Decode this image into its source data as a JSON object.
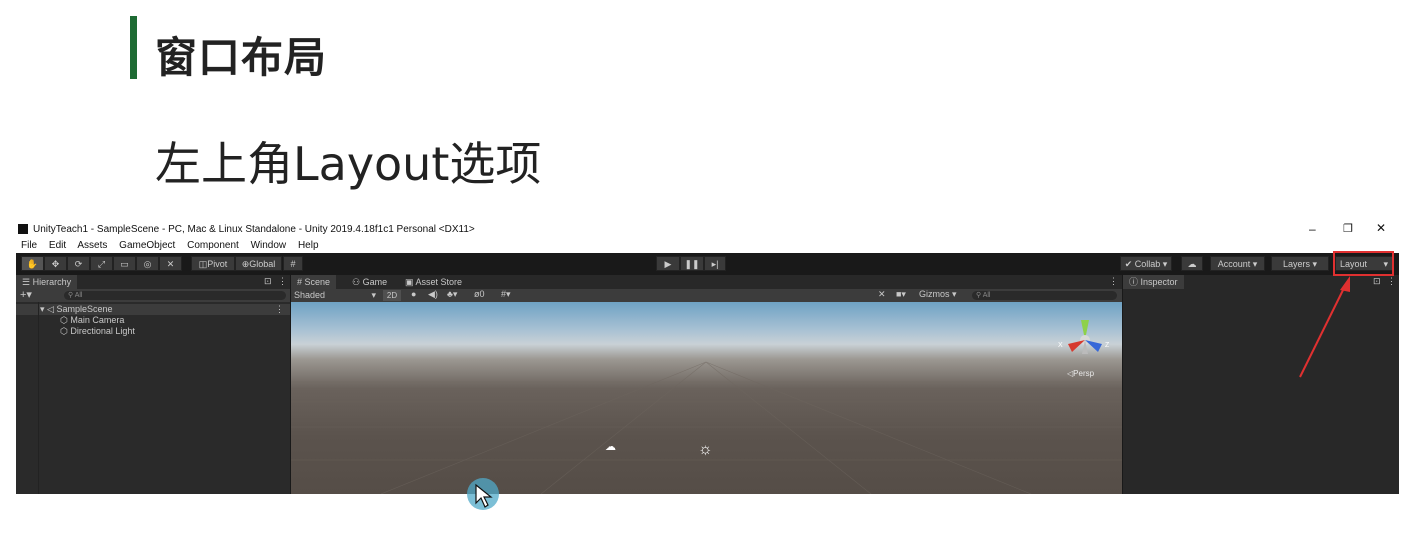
{
  "slide": {
    "title": "窗口布局",
    "subtitle": "左上角Layout选项"
  },
  "window": {
    "title": "UnityTeach1 - SampleScene - PC, Mac & Linux Standalone - Unity 2019.4.18f1c1 Personal <DX11>",
    "controls": {
      "minimize": "–",
      "restore": "❐",
      "close": "✕"
    }
  },
  "menu": [
    "File",
    "Edit",
    "Assets",
    "GameObject",
    "Component",
    "Window",
    "Help"
  ],
  "toolbar": {
    "tools": [
      "hand-tool",
      "move-tool",
      "rotate-tool",
      "scale-tool",
      "rect-tool",
      "transform-tool",
      "custom-tool"
    ],
    "pivot": "Pivot",
    "global": "Global",
    "collab": "Collab",
    "account": "Account",
    "layers": "Layers",
    "layout": "Layout"
  },
  "hierarchy": {
    "tab": "Hierarchy",
    "search_placeholder": "All",
    "scene": "SampleScene",
    "items": [
      "Main Camera",
      "Directional Light"
    ]
  },
  "scene": {
    "tabs": [
      "Scene",
      "Game",
      "Asset Store"
    ],
    "shading": "Shaded",
    "mode_2d": "2D",
    "hidden_count": "0",
    "gizmos": "Gizmos",
    "search_placeholder": "All",
    "persp": "Persp",
    "gizmo_axes": {
      "x": "X",
      "z": "Z"
    }
  },
  "inspector": {
    "tab": "Inspector"
  },
  "colors": {
    "accent_bar": "#1e6b34",
    "highlight_box": "#e03030",
    "arrow": "#e03030"
  }
}
